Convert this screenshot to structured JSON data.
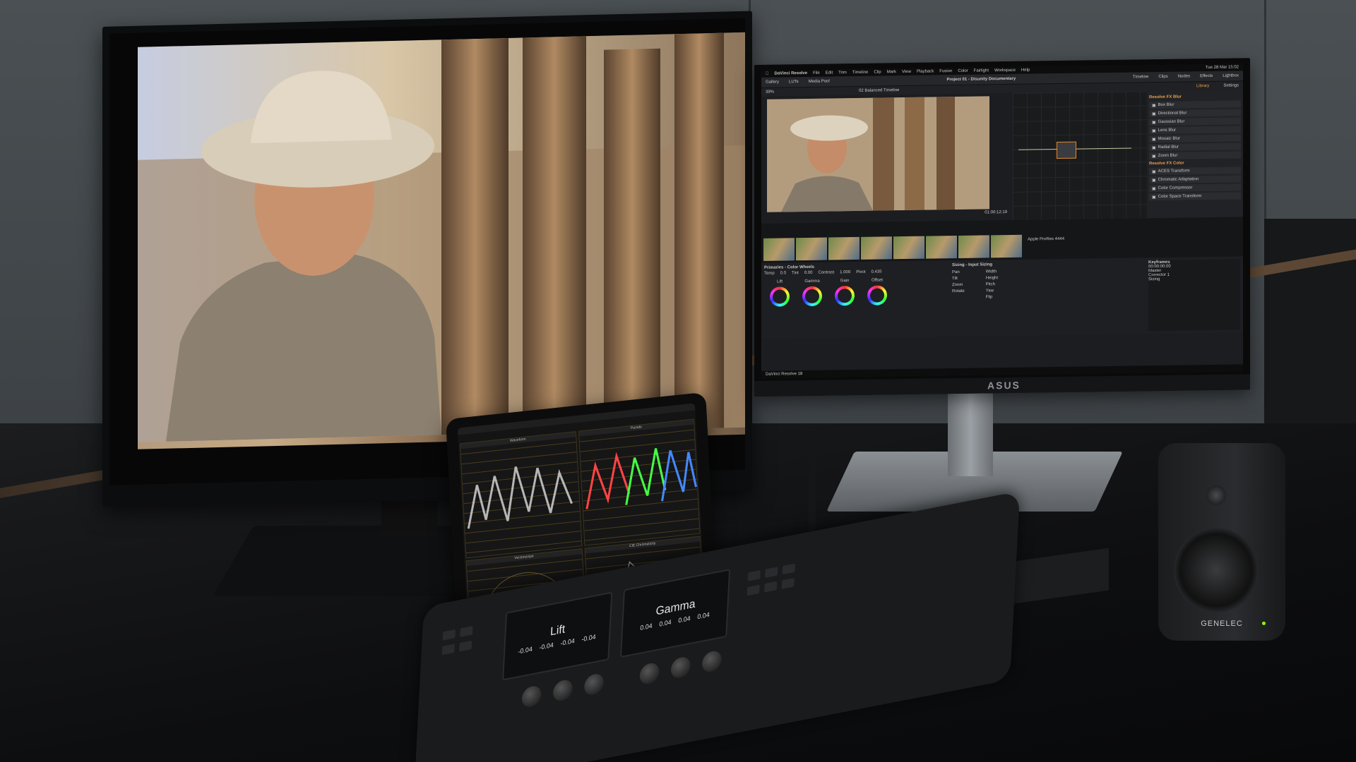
{
  "side_monitor": {
    "brand": "ASUS",
    "menubar": [
      "DaVinci Resolve",
      "File",
      "Edit",
      "Trim",
      "Timeline",
      "Clip",
      "Mark",
      "View",
      "Playback",
      "Fusion",
      "Color",
      "Fairlight",
      "Workspace",
      "Help"
    ],
    "clock": "Tue 28 Mar 15:02",
    "toolbar_items": [
      "Gallery",
      "LUTs",
      "Media Pool"
    ],
    "project_title": "Project 01 - Disunity Documentary",
    "panel_tabs": [
      "Timeline",
      "Clips",
      "Nodes",
      "Effects",
      "Lightbox"
    ],
    "timeline_name": "02 Balanced Timeline",
    "zoom": "39%",
    "timecode": "01:00:12:19",
    "fx_library_tabs": [
      "Library",
      "Settings"
    ],
    "fx_sections": [
      {
        "title": "Resolve FX Blur",
        "items": [
          "Box Blur",
          "Directional Blur",
          "Gaussian Blur",
          "Lens Blur",
          "Mosaic Blur",
          "Radial Blur",
          "Zoom Blur"
        ]
      },
      {
        "title": "Resolve FX Color",
        "items": [
          "ACES Transform",
          "Chromatic Adaptation",
          "Color Compressor",
          "Color Space Transform"
        ]
      }
    ],
    "clip_label": "Apple ProRes 4444",
    "primaries_title": "Primaries - Color Wheels",
    "wheel_labels": [
      "Lift",
      "Gamma",
      "Gain",
      "Offset"
    ],
    "temp": "0.0",
    "tint": "0.00",
    "contrast": "1.000",
    "pivot": "0.435",
    "mid_detail": "0.00",
    "sizing_title": "Sizing - Input Sizing",
    "sizing_fields": [
      "Pan",
      "Tilt",
      "Zoom",
      "Rotate"
    ],
    "sizing_fields2": [
      "Width",
      "Height",
      "Pitch",
      "Yaw",
      "Flip"
    ],
    "keyframes_title": "Keyframes",
    "keyframes_master": "Master",
    "keyframes_rows": [
      "Corrector 1",
      "Sizing"
    ],
    "keyframes_time": "00:00:00:00",
    "footer_app": "DaVinci Resolve 18"
  },
  "tablet": {
    "scopes": [
      "Waveform",
      "Parade",
      "Vectorscope",
      "CIE Chromaticity"
    ]
  },
  "control_panel": {
    "screens": [
      {
        "label": "Lift",
        "values": [
          "-0.04",
          "-0.04",
          "-0.04",
          "-0.04"
        ]
      },
      {
        "label": "Gamma",
        "values": [
          "0.04",
          "0.04",
          "0.04",
          "0.04"
        ]
      }
    ]
  },
  "speaker": {
    "brand": "GENELEC"
  }
}
